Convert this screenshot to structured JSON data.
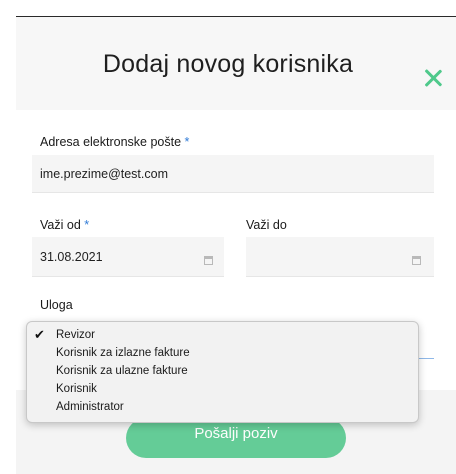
{
  "modal": {
    "title": "Dodaj novog korisnika",
    "close_icon": "close-icon",
    "accent_color": "#4fc98b"
  },
  "form": {
    "email": {
      "label": "Adresa elektronske pošte",
      "required_mark": "*",
      "value": "ime.prezime@test.com"
    },
    "valid_from": {
      "label": "Važi od",
      "required_mark": "*",
      "value": "31.08.2021",
      "icon": "calendar-icon"
    },
    "valid_to": {
      "label": "Važi do",
      "value": "",
      "icon": "calendar-icon"
    },
    "role": {
      "label": "Uloga",
      "selected": "Revizor",
      "options": [
        "Revizor",
        "Korisnik za izlazne fakture",
        "Korisnik za ulazne fakture",
        "Korisnik",
        "Administrator"
      ]
    }
  },
  "actions": {
    "submit_label": "Pošalji poziv",
    "submit_color": "#55c88e"
  }
}
